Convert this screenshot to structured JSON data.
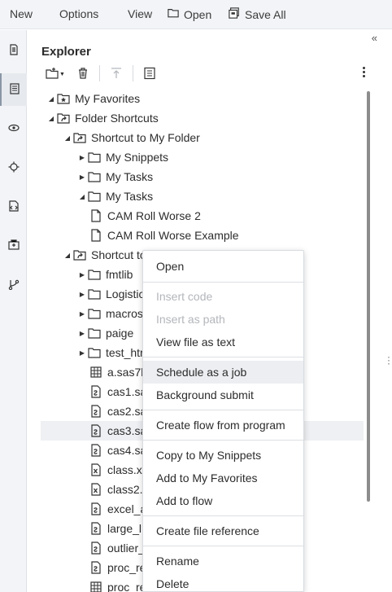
{
  "toolbar": {
    "new": "New",
    "options": "Options",
    "view": "View",
    "open": "Open",
    "save_all": "Save All"
  },
  "explorer": {
    "title": "Explorer",
    "tree": [
      "My Favorites",
      "Folder Shortcuts",
      "Shortcut to My Folder",
      "My Snippets",
      "My Tasks",
      "My Tasks",
      "CAM Roll Worse 2",
      "CAM Roll Worse Example",
      "Shortcut to",
      "fmtlib",
      "Logistic",
      "macros",
      "paige",
      "test_htr",
      "a.sas7b",
      "cas1.sa",
      "cas2.sa",
      "cas3.sa",
      "cas4.sa",
      "class.xl",
      "class2.",
      "excel_a",
      "large_l",
      "outlier_",
      "proc_re",
      "proc_re"
    ]
  },
  "context_menu": {
    "items": [
      "Open",
      "Insert code",
      "Insert as path",
      "View file as text",
      "Schedule as a job",
      "Background submit",
      "Create flow from program",
      "Copy to My Snippets",
      "Add to My Favorites",
      "Add to flow",
      "Create file reference",
      "Rename",
      "Delete"
    ]
  },
  "icons": {
    "rail": [
      "document-icon",
      "explorer-icon",
      "libraries-icon",
      "tasks-icon",
      "snippets-icon",
      "clinical-icon",
      "git-icon"
    ],
    "accent": "#8a96a6",
    "menu_hover_bg": "#eceef1",
    "row_highlight_bg": "#eef0f3"
  }
}
